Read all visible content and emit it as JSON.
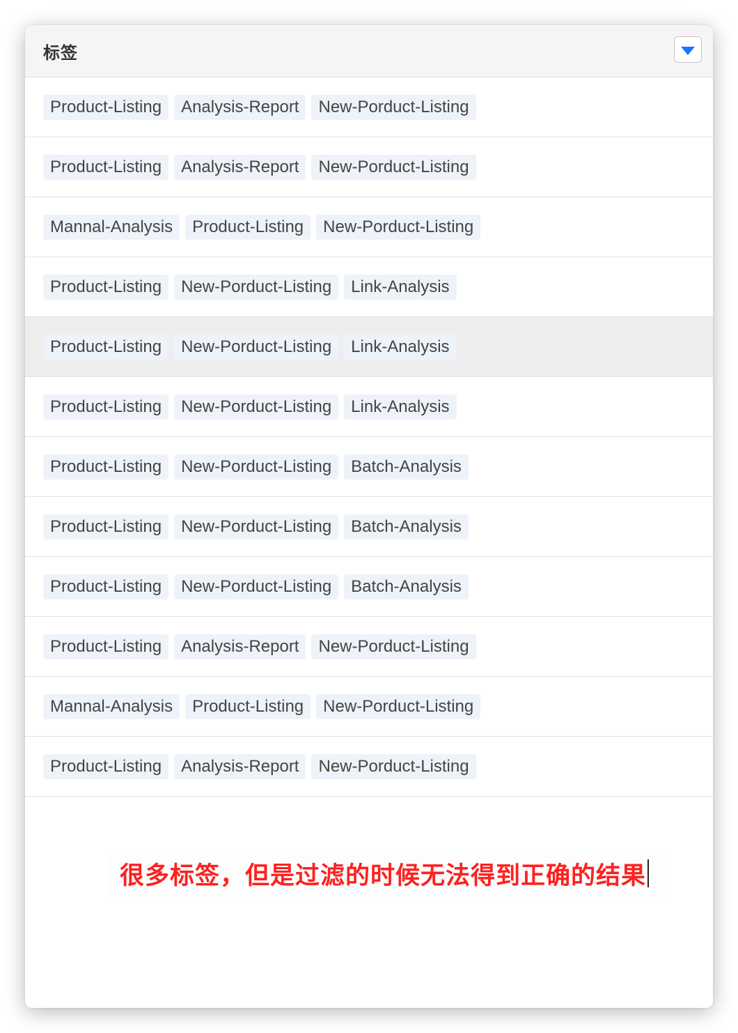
{
  "table": {
    "column_header": "标签",
    "filter_icon": "caret-down-filter-icon",
    "rows": [
      [
        "Product-Listing",
        "Analysis-Report",
        "New-Porduct-Listing"
      ],
      [
        "Product-Listing",
        "Analysis-Report",
        "New-Porduct-Listing"
      ],
      [
        "Mannal-Analysis",
        "Product-Listing",
        "New-Porduct-Listing"
      ],
      [
        "Product-Listing",
        "New-Porduct-Listing",
        "Link-Analysis"
      ],
      [
        "Product-Listing",
        "New-Porduct-Listing",
        "Link-Analysis"
      ],
      [
        "Product-Listing",
        "New-Porduct-Listing",
        "Link-Analysis"
      ],
      [
        "Product-Listing",
        "New-Porduct-Listing",
        "Batch-Analysis"
      ],
      [
        "Product-Listing",
        "New-Porduct-Listing",
        "Batch-Analysis"
      ],
      [
        "Product-Listing",
        "New-Porduct-Listing",
        "Batch-Analysis"
      ],
      [
        "Product-Listing",
        "Analysis-Report",
        "New-Porduct-Listing"
      ],
      [
        "Mannal-Analysis",
        "Product-Listing",
        "New-Porduct-Listing"
      ],
      [
        "Product-Listing",
        "Analysis-Report",
        "New-Porduct-Listing"
      ]
    ],
    "highlighted_row": 4
  },
  "annotation": {
    "text": "很多标签，但是过滤的时候无法得到正确的结果"
  },
  "colors": {
    "accent": "#1677ff",
    "annotation": "#ff2020",
    "tag_bg": "#eef2f9",
    "hover_row": "#eeeeee"
  }
}
